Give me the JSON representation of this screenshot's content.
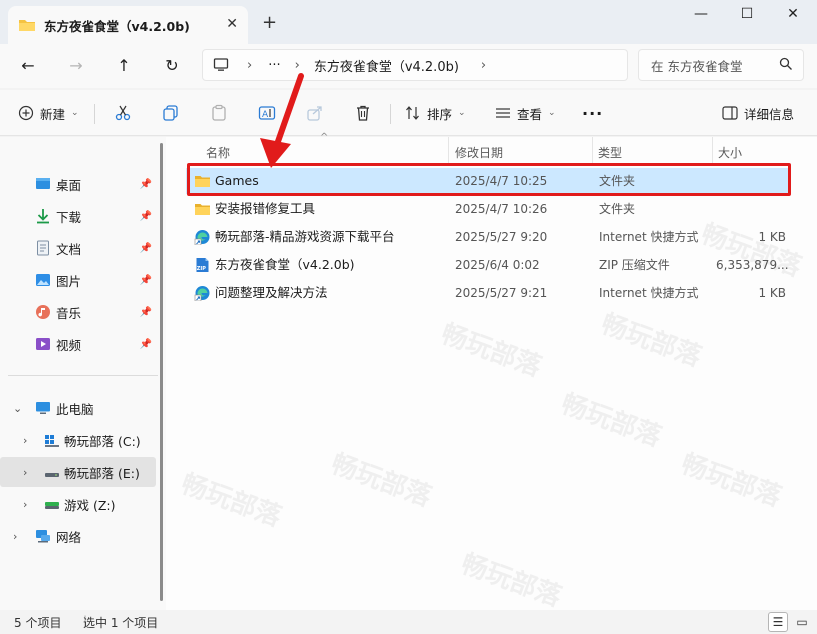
{
  "window": {
    "tab_title": "东方夜雀食堂（v4.2.0b)",
    "tab_close": "✕",
    "new_tab": "+",
    "minimize": "—",
    "maximize": "☐",
    "close": "✕"
  },
  "nav": {
    "back": "←",
    "forward": "→",
    "up": "↑",
    "refresh": "↻"
  },
  "address": {
    "ellipsis": "···",
    "segment": "东方夜雀食堂（v4.2.0b)",
    "search_placeholder": "在 东方夜雀食堂"
  },
  "toolbar": {
    "new_label": "新建",
    "sort_label": "排序",
    "view_label": "查看",
    "more_label": "···",
    "details_label": "详细信息"
  },
  "sidebar": {
    "quick_access": [
      {
        "label": "桌面",
        "icon": "desktop-icon"
      },
      {
        "label": "下载",
        "icon": "download-icon"
      },
      {
        "label": "文档",
        "icon": "documents-icon"
      },
      {
        "label": "图片",
        "icon": "pictures-icon"
      },
      {
        "label": "音乐",
        "icon": "music-icon"
      },
      {
        "label": "视频",
        "icon": "videos-icon"
      }
    ],
    "this_pc": "此电脑",
    "drives": [
      {
        "label": "畅玩部落 (C:)",
        "selected": false
      },
      {
        "label": "畅玩部落 (E:)",
        "selected": true
      },
      {
        "label": "游戏 (Z:)",
        "selected": false
      }
    ],
    "network": "网络"
  },
  "columns": {
    "name": "名称",
    "modified": "修改日期",
    "type": "类型",
    "size": "大小"
  },
  "files": [
    {
      "name": "Games",
      "date": "2025/4/7 10:25",
      "type": "文件夹",
      "size": "",
      "icon": "folder-icon",
      "selected": true
    },
    {
      "name": "安装报错修复工具",
      "date": "2025/4/7 10:26",
      "type": "文件夹",
      "size": "",
      "icon": "folder-icon",
      "selected": false
    },
    {
      "name": "畅玩部落-精品游戏资源下载平台",
      "date": "2025/5/27 9:20",
      "type": "Internet 快捷方式",
      "size": "1 KB",
      "icon": "edge-shortcut-icon",
      "selected": false
    },
    {
      "name": "东方夜雀食堂（v4.2.0b)",
      "date": "2025/6/4 0:02",
      "type": "ZIP 压缩文件",
      "size": "6,353,879...",
      "icon": "zip-icon",
      "selected": false
    },
    {
      "name": "问题整理及解决方法",
      "date": "2025/5/27 9:21",
      "type": "Internet 快捷方式",
      "size": "1 KB",
      "icon": "edge-shortcut-icon",
      "selected": false
    }
  ],
  "status": {
    "count": "5 个项目",
    "selected": "选中 1 个项目"
  },
  "watermark": "畅玩部落",
  "colors": {
    "accent": "#0067c0",
    "selection": "#cce8ff",
    "highlight_box": "#e11b1b",
    "folder": "#f5c342"
  }
}
